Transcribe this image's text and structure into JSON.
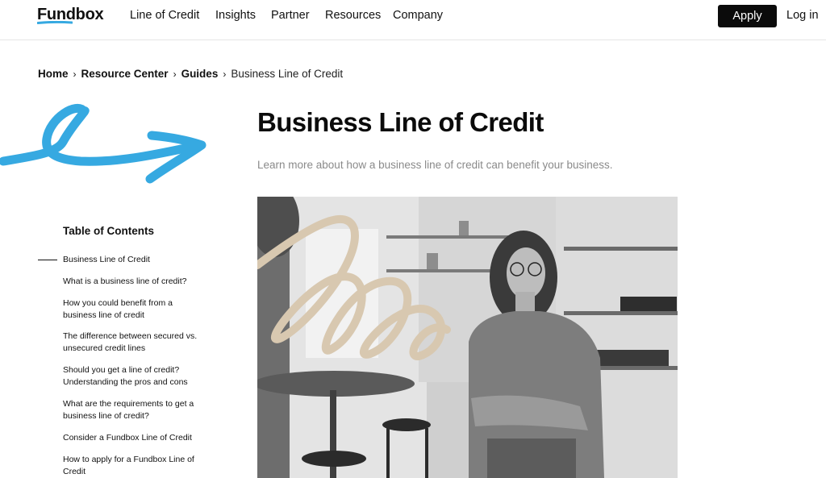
{
  "header": {
    "logo": "Fundbox",
    "nav": [
      "Line of Credit",
      "Insights",
      "Partner",
      "Resources",
      "Company"
    ],
    "apply_label": "Apply",
    "login_label": "Log in"
  },
  "breadcrumb": {
    "items": [
      "Home",
      "Resource Center",
      "Guides"
    ],
    "current": "Business Line of Credit",
    "separator": "›"
  },
  "page": {
    "title": "Business Line of Credit",
    "subtitle": "Learn more about how a business line of credit can benefit your business."
  },
  "toc": {
    "heading": "Table of Contents",
    "items": [
      [
        "Business Line of Credit"
      ],
      [
        "What is a business line of credit?"
      ],
      [
        "How you could benefit from a",
        "business line of credit"
      ],
      [
        "The difference between secured vs.",
        "unsecured credit lines"
      ],
      [
        "Should you get a line of credit?",
        "Understanding the pros and cons"
      ],
      [
        "What are the requirements to get a",
        "business line of credit?"
      ],
      [
        "Consider a Fundbox Line of Credit"
      ],
      [
        "How to apply for a Fundbox Line of",
        "Credit"
      ]
    ]
  },
  "colors": {
    "accent_blue": "#36a9e1",
    "scribble_beige": "#d8c8b0",
    "button_bg": "#0b0b0b"
  }
}
